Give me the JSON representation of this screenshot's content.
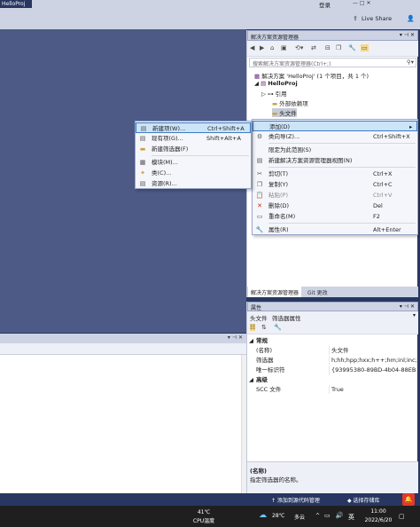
{
  "window": {
    "title_tab": "HelloProj",
    "login_label": "登录",
    "window_controls": "—  □  ✕",
    "live_share_label": "Live Share"
  },
  "solution_explorer": {
    "title": "解决方案资源管理器",
    "search_placeholder": "搜索解决方案资源管理器(Ctrl+;)",
    "tree": [
      {
        "label": "解决方案 'HelloProj' (1 个项目，共 1 个)",
        "icon": "solution-icon",
        "indent": 0
      },
      {
        "label": "HelloProj",
        "icon": "project-icon",
        "indent": 1,
        "bold": true
      },
      {
        "label": "引用",
        "icon": "references-icon",
        "indent": 2
      },
      {
        "label": "外部依赖项",
        "icon": "external-deps-icon",
        "indent": 2
      },
      {
        "label": "头文件",
        "icon": "folder-icon",
        "indent": 2,
        "selected": true
      }
    ],
    "bottom_tabs": [
      "解决方案资源管理器",
      "Git 更改"
    ]
  },
  "context_menu": {
    "items": [
      {
        "label": "添加(D)",
        "shortcut": "",
        "icon": "",
        "highlighted": true,
        "has_submenu": true
      },
      {
        "label": "类向导(Z)...",
        "shortcut": "Ctrl+Shift+X",
        "icon": "class-wizard-icon"
      },
      {
        "label": "限定为此范围(S)",
        "shortcut": "",
        "icon": "",
        "sep_before": true
      },
      {
        "label": "新建解决方案资源管理器视图(N)",
        "shortcut": "",
        "icon": "new-view-icon"
      },
      {
        "label": "剪切(T)",
        "shortcut": "Ctrl+X",
        "icon": "cut-icon",
        "sep_before": true
      },
      {
        "label": "复制(Y)",
        "shortcut": "Ctrl+C",
        "icon": "copy-icon"
      },
      {
        "label": "粘贴(P)",
        "shortcut": "Ctrl+V",
        "icon": "paste-icon",
        "disabled": true
      },
      {
        "label": "删除(D)",
        "shortcut": "Del",
        "icon": "delete-icon"
      },
      {
        "label": "重命名(M)",
        "shortcut": "F2",
        "icon": "rename-icon"
      },
      {
        "label": "属性(R)",
        "shortcut": "Alt+Enter",
        "icon": "properties-icon",
        "sep_before": true
      }
    ]
  },
  "submenu": {
    "items": [
      {
        "label": "新建项(W)...",
        "shortcut": "Ctrl+Shift+A",
        "icon": "new-item-icon",
        "highlighted": true
      },
      {
        "label": "现有项(G)...",
        "shortcut": "Shift+Alt+A",
        "icon": "existing-item-icon"
      },
      {
        "label": "新建筛选器(F)",
        "shortcut": "",
        "icon": "new-filter-icon"
      },
      {
        "label": "模块(M)...",
        "shortcut": "",
        "icon": "module-icon",
        "sep_before": true
      },
      {
        "label": "类(C)...",
        "shortcut": "",
        "icon": "class-icon"
      },
      {
        "label": "资源(R)...",
        "shortcut": "",
        "icon": "resource-icon"
      }
    ]
  },
  "properties": {
    "title": "属性",
    "object_name": "头文件",
    "object_type": "筛选器属性",
    "rows": [
      {
        "category": "常规"
      },
      {
        "name": "(名称)",
        "value": "头文件"
      },
      {
        "name": "筛选器",
        "value": "h;hh;hpp;hxx;h++;hm;inl;inc;ipp"
      },
      {
        "name": "唯一标识符",
        "value": "{93995380-89BD-4b04-88EB-6"
      },
      {
        "category": "高级"
      },
      {
        "name": "SCC 文件",
        "value": "True"
      }
    ],
    "desc_title": "(名称)",
    "desc_text": "指定筛选器的名称。"
  },
  "status_bar": {
    "add_source_control": "↑  添加到源代码管理",
    "select_repo": "◆  选择存储库",
    "notifications": "🔔"
  },
  "taskbar": {
    "cpu_temp": "41℃",
    "cpu_label": "CPU温度",
    "weather_temp": "28℃",
    "weather_desc": "多云",
    "input_lang": "英",
    "time": "11:00",
    "date": "2022/6/20"
  }
}
